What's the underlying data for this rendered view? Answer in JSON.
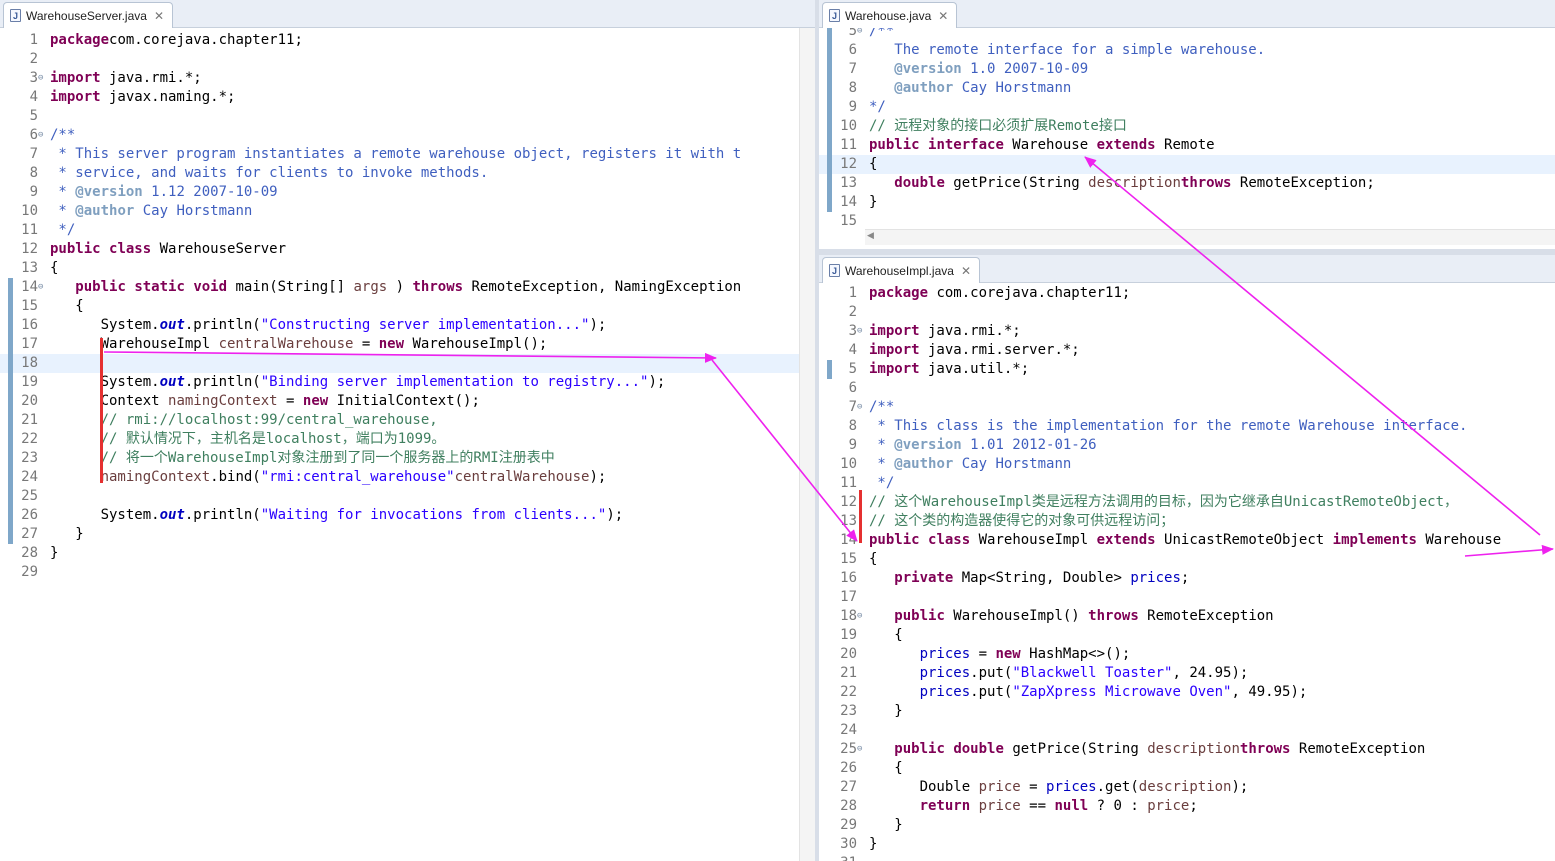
{
  "panes": [
    {
      "id": "server",
      "tab_label": "WarehouseServer.java",
      "lines": [
        {
          "n": "1",
          "t": [
            [
              "kw",
              "package"
            ],
            [
              "",
              "com.corejava.chapter11;"
            ]
          ]
        },
        {
          "n": "2",
          "t": []
        },
        {
          "n": "3",
          "fold": "⊖",
          "t": [
            [
              "kw",
              "import"
            ],
            [
              "",
              " java.rmi.*;"
            ]
          ]
        },
        {
          "n": "4",
          "t": [
            [
              "kw",
              "import"
            ],
            [
              "",
              " javax.naming.*;"
            ]
          ]
        },
        {
          "n": "5",
          "t": []
        },
        {
          "n": "6",
          "fold": "⊖",
          "t": [
            [
              "doc",
              "/**"
            ]
          ]
        },
        {
          "n": "7",
          "t": [
            [
              "doc",
              " * This server program instantiates a remote warehouse object, registers it with t"
            ]
          ]
        },
        {
          "n": "8",
          "t": [
            [
              "doc",
              " * service, and waits for clients to invoke methods."
            ]
          ]
        },
        {
          "n": "9",
          "t": [
            [
              "doc",
              " * "
            ],
            [
              "tag",
              "@version"
            ],
            [
              "doc",
              " 1.12 2007-10-09"
            ]
          ]
        },
        {
          "n": "10",
          "t": [
            [
              "doc",
              " * "
            ],
            [
              "tag",
              "@author"
            ],
            [
              "doc",
              " Cay Horstmann"
            ]
          ]
        },
        {
          "n": "11",
          "t": [
            [
              "doc",
              " */"
            ]
          ]
        },
        {
          "n": "12",
          "t": [
            [
              "kw",
              "public"
            ],
            [
              "",
              " "
            ],
            [
              "kw",
              "class"
            ],
            [
              "",
              " WarehouseServer"
            ]
          ]
        },
        {
          "n": "13",
          "t": [
            [
              "",
              "{"
            ]
          ]
        },
        {
          "n": "14",
          "fold": "⊖",
          "t": [
            [
              "",
              "   "
            ],
            [
              "kw",
              "public"
            ],
            [
              "",
              " "
            ],
            [
              "kw",
              "static"
            ],
            [
              "",
              " "
            ],
            [
              "kw",
              "void"
            ],
            [
              "",
              " main(String[] "
            ],
            [
              "lvar",
              "args"
            ],
            [
              "",
              " ) "
            ],
            [
              "kw",
              "throws"
            ],
            [
              "",
              " RemoteException, NamingException"
            ]
          ]
        },
        {
          "n": "15",
          "t": [
            [
              "",
              "   {"
            ]
          ]
        },
        {
          "n": "16",
          "t": [
            [
              "",
              "      System."
            ],
            [
              "sfld",
              "out"
            ],
            [
              "",
              ".println("
            ],
            [
              "str",
              "\"Constructing server implementation...\""
            ],
            [
              "",
              ");"
            ]
          ]
        },
        {
          "n": "17",
          "t": [
            [
              "",
              "      WarehouseImpl "
            ],
            [
              "lvar",
              "centralWarehouse"
            ],
            [
              "",
              " = "
            ],
            [
              "kw",
              "new"
            ],
            [
              "",
              " WarehouseImpl();"
            ]
          ]
        },
        {
          "n": "18",
          "hl": true,
          "t": []
        },
        {
          "n": "19",
          "t": [
            [
              "",
              "      System."
            ],
            [
              "sfld",
              "out"
            ],
            [
              "",
              ".println("
            ],
            [
              "str",
              "\"Binding server implementation to registry...\""
            ],
            [
              "",
              ");"
            ]
          ]
        },
        {
          "n": "20",
          "t": [
            [
              "",
              "      Context "
            ],
            [
              "lvar",
              "namingContext"
            ],
            [
              "",
              " = "
            ],
            [
              "kw",
              "new"
            ],
            [
              "",
              " InitialContext();"
            ]
          ]
        },
        {
          "n": "21",
          "t": [
            [
              "cm",
              "      // rmi://localhost:99/central_warehouse,"
            ]
          ]
        },
        {
          "n": "22",
          "t": [
            [
              "cm",
              "      // 默认情况下，主机名是localhost，端口为1099。"
            ]
          ]
        },
        {
          "n": "23",
          "t": [
            [
              "cm",
              "      // 将一个WarehouseImpl对象注册到了同一个服务器上的RMI注册表中"
            ]
          ]
        },
        {
          "n": "24",
          "t": [
            [
              "",
              "      "
            ],
            [
              "lvar",
              "namingContext"
            ],
            [
              "",
              ".bind("
            ],
            [
              "str",
              "\"rmi:central_warehouse\""
            ],
            [
              ", "
            ],
            [
              "lvar",
              "centralWarehouse"
            ],
            [
              "",
              ");"
            ]
          ]
        },
        {
          "n": "25",
          "t": []
        },
        {
          "n": "26",
          "t": [
            [
              "",
              "      System."
            ],
            [
              "sfld",
              "out"
            ],
            [
              "",
              ".println("
            ],
            [
              "str",
              "\"Waiting for invocations from clients...\""
            ],
            [
              "",
              ");"
            ]
          ]
        },
        {
          "n": "27",
          "t": [
            [
              "",
              "   }"
            ]
          ]
        },
        {
          "n": "28",
          "t": [
            [
              "",
              "}"
            ]
          ]
        },
        {
          "n": "29",
          "t": []
        }
      ]
    },
    {
      "id": "warehouse",
      "tab_label": "Warehouse.java",
      "lines": [
        {
          "n": "5",
          "fold": "⊖",
          "t": [
            [
              "doc",
              "/**"
            ]
          ]
        },
        {
          "n": "6",
          "t": [
            [
              "doc",
              "   The remote interface for a simple warehouse."
            ]
          ]
        },
        {
          "n": "7",
          "t": [
            [
              "doc",
              "   "
            ],
            [
              "tag",
              "@version"
            ],
            [
              "doc",
              " 1.0 2007-10-09"
            ]
          ]
        },
        {
          "n": "8",
          "t": [
            [
              "doc",
              "   "
            ],
            [
              "tag",
              "@author"
            ],
            [
              "doc",
              " Cay Horstmann"
            ]
          ]
        },
        {
          "n": "9",
          "t": [
            [
              "doc",
              "*/"
            ]
          ]
        },
        {
          "n": "10",
          "t": [
            [
              "cm",
              "// 远程对象的接口必须扩展Remote接口"
            ]
          ]
        },
        {
          "n": "11",
          "t": [
            [
              "kw",
              "public"
            ],
            [
              "",
              " "
            ],
            [
              "kw",
              "interface"
            ],
            [
              "",
              " Warehouse "
            ],
            [
              "kw",
              "extends"
            ],
            [
              "",
              " Remote"
            ]
          ]
        },
        {
          "n": "12",
          "hl": true,
          "t": [
            [
              "",
              "{"
            ]
          ]
        },
        {
          "n": "13",
          "t": [
            [
              "",
              "   "
            ],
            [
              "kw",
              "double"
            ],
            [
              "",
              " getPrice(String "
            ],
            [
              "lvar",
              "description"
            ],
            [
              ") "
            ],
            [
              "kw",
              "throws"
            ],
            [
              "",
              " RemoteException;"
            ]
          ]
        },
        {
          "n": "14",
          "t": [
            [
              "",
              "}"
            ]
          ]
        },
        {
          "n": "15",
          "t": []
        }
      ]
    },
    {
      "id": "impl",
      "tab_label": "WarehouseImpl.java",
      "lines": [
        {
          "n": "1",
          "t": [
            [
              "kw",
              "package"
            ],
            [
              "",
              " com.corejava.chapter11;"
            ]
          ]
        },
        {
          "n": "2",
          "t": []
        },
        {
          "n": "3",
          "fold": "⊖",
          "t": [
            [
              "kw",
              "import"
            ],
            [
              "",
              " java.rmi.*;"
            ]
          ]
        },
        {
          "n": "4",
          "t": [
            [
              "kw",
              "import"
            ],
            [
              "",
              " java.rmi.server.*;"
            ]
          ]
        },
        {
          "n": "5",
          "t": [
            [
              "kw",
              "import"
            ],
            [
              "",
              " java.util.*;"
            ]
          ]
        },
        {
          "n": "6",
          "t": []
        },
        {
          "n": "7",
          "fold": "⊖",
          "t": [
            [
              "doc",
              "/**"
            ]
          ]
        },
        {
          "n": "8",
          "t": [
            [
              "doc",
              " * This class is the implementation for the remote Warehouse interface."
            ]
          ]
        },
        {
          "n": "9",
          "t": [
            [
              "doc",
              " * "
            ],
            [
              "tag",
              "@version"
            ],
            [
              "doc",
              " 1.01 2012-01-26"
            ]
          ]
        },
        {
          "n": "10",
          "t": [
            [
              "doc",
              " * "
            ],
            [
              "tag",
              "@author"
            ],
            [
              "doc",
              " Cay Horstmann"
            ]
          ]
        },
        {
          "n": "11",
          "t": [
            [
              "doc",
              " */"
            ]
          ]
        },
        {
          "n": "12",
          "t": [
            [
              "cm",
              "// 这个WarehouseImpl类是远程方法调用的目标，因为它继承自UnicastRemoteObject，"
            ]
          ]
        },
        {
          "n": "13",
          "t": [
            [
              "cm",
              "// 这个类的构造器使得它的对象可供远程访问；"
            ]
          ]
        },
        {
          "n": "14",
          "t": [
            [
              "kw",
              "public"
            ],
            [
              "",
              " "
            ],
            [
              "kw",
              "class"
            ],
            [
              "",
              " WarehouseImpl "
            ],
            [
              "kw",
              "extends"
            ],
            [
              "",
              " UnicastRemoteObject "
            ],
            [
              "kw",
              "implements"
            ],
            [
              "",
              " Warehouse"
            ]
          ]
        },
        {
          "n": "15",
          "t": [
            [
              "",
              "{"
            ]
          ]
        },
        {
          "n": "16",
          "t": [
            [
              "",
              "   "
            ],
            [
              "kw",
              "private"
            ],
            [
              "",
              " Map<String, Double> "
            ],
            [
              "field",
              "prices"
            ],
            [
              "",
              ";"
            ]
          ]
        },
        {
          "n": "17",
          "t": []
        },
        {
          "n": "18",
          "fold": "⊖",
          "t": [
            [
              "",
              "   "
            ],
            [
              "kw",
              "public"
            ],
            [
              "",
              " WarehouseImpl() "
            ],
            [
              "kw",
              "throws"
            ],
            [
              "",
              " RemoteException"
            ]
          ]
        },
        {
          "n": "19",
          "t": [
            [
              "",
              "   {"
            ]
          ]
        },
        {
          "n": "20",
          "t": [
            [
              "",
              "      "
            ],
            [
              "field",
              "prices"
            ],
            [
              "",
              " = "
            ],
            [
              "kw",
              "new"
            ],
            [
              "",
              " HashMap<>();"
            ]
          ]
        },
        {
          "n": "21",
          "t": [
            [
              "",
              "      "
            ],
            [
              "field",
              "prices"
            ],
            [
              "",
              ".put("
            ],
            [
              "str",
              "\"Blackwell Toaster\""
            ],
            [
              "",
              ", 24.95);"
            ]
          ]
        },
        {
          "n": "22",
          "t": [
            [
              "",
              "      "
            ],
            [
              "field",
              "prices"
            ],
            [
              "",
              ".put("
            ],
            [
              "str",
              "\"ZapXpress Microwave Oven\""
            ],
            [
              "",
              ", 49.95);"
            ]
          ]
        },
        {
          "n": "23",
          "t": [
            [
              "",
              "   }"
            ]
          ]
        },
        {
          "n": "24",
          "t": []
        },
        {
          "n": "25",
          "fold": "⊖",
          "t": [
            [
              "",
              "   "
            ],
            [
              "kw",
              "public"
            ],
            [
              "",
              " "
            ],
            [
              "kw",
              "double"
            ],
            [
              "",
              " getPrice(String "
            ],
            [
              "lvar",
              "description"
            ],
            [
              ") "
            ],
            [
              "kw",
              "throws"
            ],
            [
              "",
              " RemoteException"
            ]
          ]
        },
        {
          "n": "26",
          "t": [
            [
              "",
              "   {"
            ]
          ]
        },
        {
          "n": "27",
          "t": [
            [
              "",
              "      Double "
            ],
            [
              "lvar",
              "price"
            ],
            [
              "",
              " = "
            ],
            [
              "field",
              "prices"
            ],
            [
              "",
              ".get("
            ],
            [
              "lvar",
              "description"
            ],
            [
              "",
              ");"
            ]
          ]
        },
        {
          "n": "28",
          "t": [
            [
              "",
              "      "
            ],
            [
              "kw",
              "return"
            ],
            [
              "",
              " "
            ],
            [
              "lvar",
              "price"
            ],
            [
              "",
              " == "
            ],
            [
              "kw",
              "null"
            ],
            [
              "",
              " ? 0 : "
            ],
            [
              "lvar",
              "price"
            ],
            [
              "",
              ";"
            ]
          ]
        },
        {
          "n": "29",
          "t": [
            [
              "",
              "   }"
            ]
          ]
        },
        {
          "n": "30",
          "t": [
            [
              "",
              "}"
            ]
          ]
        },
        {
          "n": "31",
          "t": []
        }
      ]
    }
  ],
  "colors": {
    "arrow": "#ee22ee",
    "redmark": "#e53030",
    "current_line": "#e8f2fe"
  }
}
